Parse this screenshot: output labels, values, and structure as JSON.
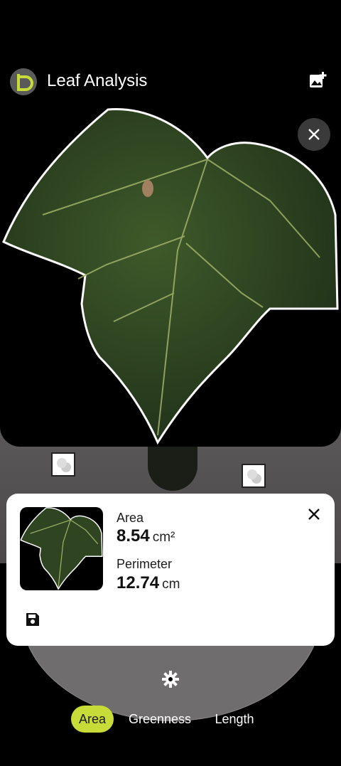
{
  "app": {
    "title": "Leaf Analysis"
  },
  "result": {
    "area_label": "Area",
    "area_value": "8.54",
    "area_unit": "cm²",
    "perimeter_label": "Perimeter",
    "perimeter_value": "12.74",
    "perimeter_unit": "cm"
  },
  "tabs": [
    {
      "label": "Area",
      "active": true
    },
    {
      "label": "Greenness",
      "active": false
    },
    {
      "label": "Length",
      "active": false
    }
  ],
  "icons": {
    "logo": "app-logo-icon",
    "add_photo": "add-photo-icon",
    "close": "close-icon",
    "save": "save-icon",
    "settings": "gear-icon"
  },
  "colors": {
    "accent": "#c7dc38",
    "card": "#ffffff",
    "background": "#000000"
  }
}
